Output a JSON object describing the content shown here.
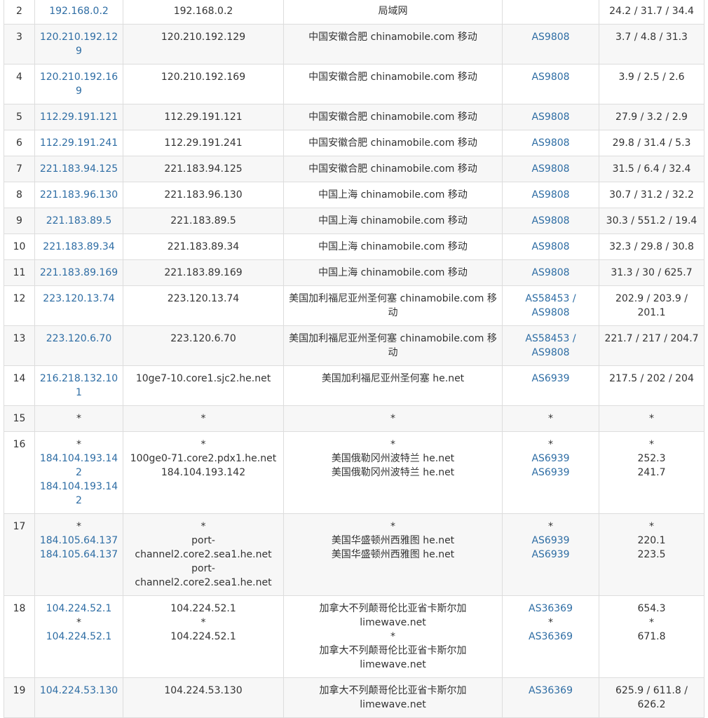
{
  "rows": [
    {
      "hop": "2",
      "ip": [
        "192.168.0.2"
      ],
      "host": [
        "192.168.0.2"
      ],
      "loc": [
        "局域网"
      ],
      "asn": [
        ""
      ],
      "time": "24.2 / 31.7 / 34.4"
    },
    {
      "hop": "3",
      "ip": [
        "120.210.192.129"
      ],
      "host": [
        "120.210.192.129"
      ],
      "loc": [
        "中国安徽合肥 chinamobile.com 移动"
      ],
      "asn": [
        "AS9808"
      ],
      "time": "3.7 / 4.8 / 31.3"
    },
    {
      "hop": "4",
      "ip": [
        "120.210.192.169"
      ],
      "host": [
        "120.210.192.169"
      ],
      "loc": [
        "中国安徽合肥 chinamobile.com 移动"
      ],
      "asn": [
        "AS9808"
      ],
      "time": "3.9 / 2.5 / 2.6"
    },
    {
      "hop": "5",
      "ip": [
        "112.29.191.121"
      ],
      "host": [
        "112.29.191.121"
      ],
      "loc": [
        "中国安徽合肥 chinamobile.com 移动"
      ],
      "asn": [
        "AS9808"
      ],
      "time": "27.9 / 3.2 / 2.9"
    },
    {
      "hop": "6",
      "ip": [
        "112.29.191.241"
      ],
      "host": [
        "112.29.191.241"
      ],
      "loc": [
        "中国安徽合肥 chinamobile.com 移动"
      ],
      "asn": [
        "AS9808"
      ],
      "time": "29.8 / 31.4 / 5.3"
    },
    {
      "hop": "7",
      "ip": [
        "221.183.94.125"
      ],
      "host": [
        "221.183.94.125"
      ],
      "loc": [
        "中国安徽合肥 chinamobile.com 移动"
      ],
      "asn": [
        "AS9808"
      ],
      "time": "31.5 / 6.4 / 32.4"
    },
    {
      "hop": "8",
      "ip": [
        "221.183.96.130"
      ],
      "host": [
        "221.183.96.130"
      ],
      "loc": [
        "中国上海 chinamobile.com 移动"
      ],
      "asn": [
        "AS9808"
      ],
      "time": "30.7 / 31.2 / 32.2"
    },
    {
      "hop": "9",
      "ip": [
        "221.183.89.5"
      ],
      "host": [
        "221.183.89.5"
      ],
      "loc": [
        "中国上海 chinamobile.com 移动"
      ],
      "asn": [
        "AS9808"
      ],
      "time": "30.3 / 551.2 / 19.4"
    },
    {
      "hop": "10",
      "ip": [
        "221.183.89.34"
      ],
      "host": [
        "221.183.89.34"
      ],
      "loc": [
        "中国上海 chinamobile.com 移动"
      ],
      "asn": [
        "AS9808"
      ],
      "time": "32.3 / 29.8 / 30.8"
    },
    {
      "hop": "11",
      "ip": [
        "221.183.89.169"
      ],
      "host": [
        "221.183.89.169"
      ],
      "loc": [
        "中国上海 chinamobile.com 移动"
      ],
      "asn": [
        "AS9808"
      ],
      "time": "31.3 / 30 / 625.7"
    },
    {
      "hop": "12",
      "ip": [
        "223.120.13.74"
      ],
      "host": [
        "223.120.13.74"
      ],
      "loc": [
        "美国加利福尼亚州圣何塞 chinamobile.com 移动"
      ],
      "asn": [
        "AS58453 / AS9808"
      ],
      "time": "202.9 / 203.9 / 201.1"
    },
    {
      "hop": "13",
      "ip": [
        "223.120.6.70"
      ],
      "host": [
        "223.120.6.70"
      ],
      "loc": [
        "美国加利福尼亚州圣何塞 chinamobile.com 移动"
      ],
      "asn": [
        "AS58453 / AS9808"
      ],
      "time": "221.7 / 217 / 204.7"
    },
    {
      "hop": "14",
      "ip": [
        "216.218.132.101"
      ],
      "host": [
        "10ge7-10.core1.sjc2.he.net"
      ],
      "loc": [
        "美国加利福尼亚州圣何塞 he.net"
      ],
      "asn": [
        "AS6939"
      ],
      "time": "217.5 / 202 / 204"
    },
    {
      "hop": "15",
      "ip": [
        "*"
      ],
      "host": [
        "*"
      ],
      "loc": [
        "*"
      ],
      "asn": [
        "*"
      ],
      "time": "*"
    },
    {
      "hop": "16",
      "ip": [
        "*",
        "184.104.193.142",
        "184.104.193.142"
      ],
      "host": [
        "*",
        "100ge0-71.core2.pdx1.he.net",
        "184.104.193.142"
      ],
      "loc": [
        "*",
        "美国俄勒冈州波特兰 he.net",
        "美国俄勒冈州波特兰 he.net"
      ],
      "asn": [
        "*",
        "AS6939",
        "AS6939"
      ],
      "time": [
        "*",
        "252.3",
        "241.7"
      ]
    },
    {
      "hop": "17",
      "ip": [
        "*",
        "184.105.64.137",
        "184.105.64.137"
      ],
      "host": [
        "*",
        "port-channel2.core2.sea1.he.net",
        "port-channel2.core2.sea1.he.net"
      ],
      "loc": [
        "*",
        "美国华盛顿州西雅图 he.net",
        "美国华盛顿州西雅图 he.net"
      ],
      "asn": [
        "*",
        "AS6939",
        "AS6939"
      ],
      "time": [
        "*",
        "220.1",
        "223.5"
      ]
    },
    {
      "hop": "18",
      "ip": [
        "104.224.52.1",
        "*",
        "104.224.52.1"
      ],
      "host": [
        "104.224.52.1",
        "*",
        "104.224.52.1"
      ],
      "loc": [
        "加拿大不列颠哥伦比亚省卡斯尔加 limewave.net",
        "*",
        "加拿大不列颠哥伦比亚省卡斯尔加 limewave.net"
      ],
      "asn": [
        "AS36369",
        "*",
        "AS36369"
      ],
      "time": [
        "654.3",
        "*",
        "671.8"
      ]
    },
    {
      "hop": "19",
      "ip": [
        "104.224.53.130"
      ],
      "host": [
        "104.224.53.130"
      ],
      "loc": [
        "加拿大不列颠哥伦比亚省卡斯尔加 limewave.net"
      ],
      "asn": [
        "AS36369"
      ],
      "time": "625.9 / 611.8 / 626.2"
    }
  ],
  "colors": {
    "link": "#2e6da4",
    "text": "#333333",
    "border": "#dddddd",
    "stripe": "#f7f7f7"
  }
}
